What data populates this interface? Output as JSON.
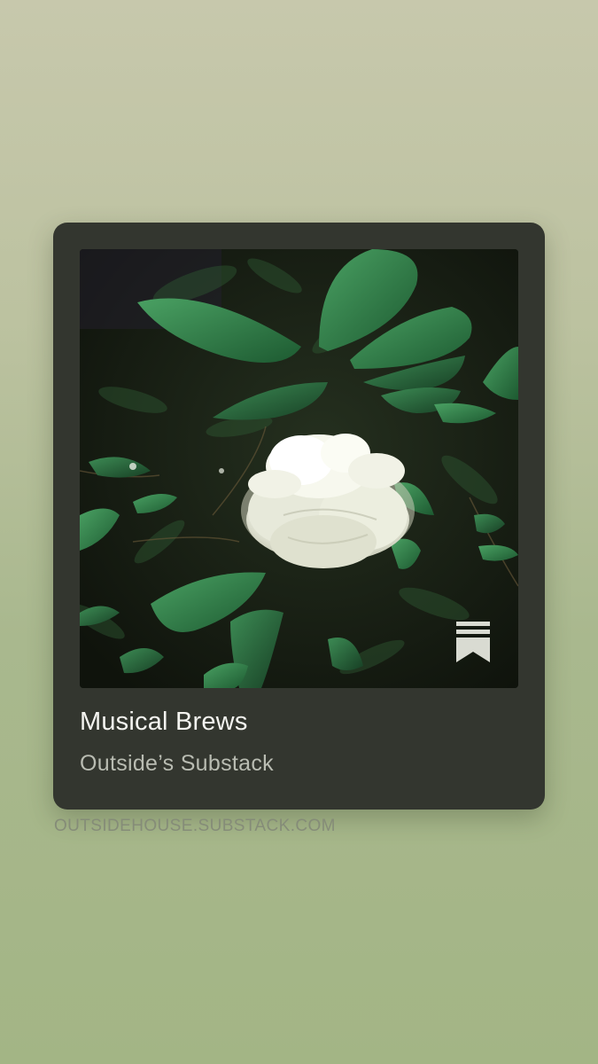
{
  "card": {
    "title": "Musical Brews",
    "subtitle": "Outside’s Substack",
    "artwork_icon": "white-camellia-flower-photo",
    "badge_icon": "substack-logo-icon"
  },
  "footer": {
    "domain": "OUTSIDEHOUSE.SUBSTACK.COM"
  },
  "colors": {
    "card_background": "#33362f",
    "title": "#f4f4f0",
    "subtitle": "#b9bcb2",
    "domain": "#858c78",
    "page_background_top": "#c7c8ac",
    "page_background_bottom": "#a3b585"
  }
}
